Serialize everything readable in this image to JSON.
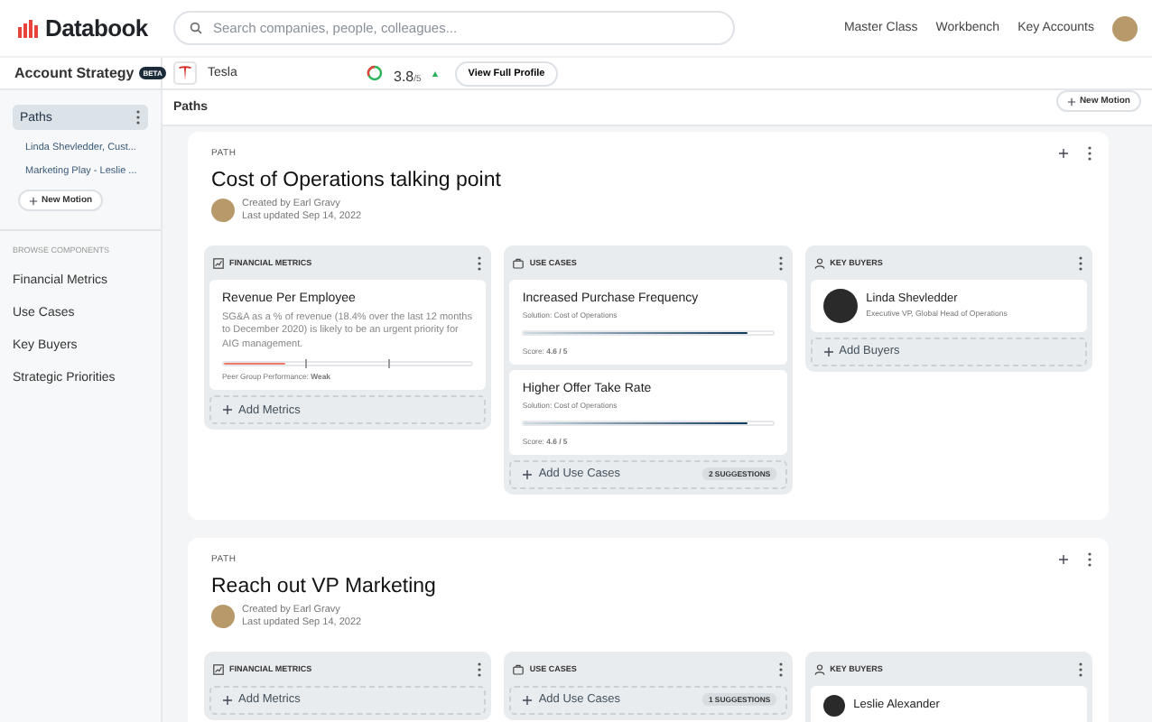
{
  "topbar": {
    "brand": "Databook",
    "search": {
      "placeholder": "Search companies, people, colleagues..."
    },
    "links": [
      "Master Class",
      "Workbench",
      "Key Accounts"
    ]
  },
  "sidebar": {
    "title": "Account Strategy",
    "badge": "BETA",
    "section": {
      "label": "Paths",
      "selected": true
    },
    "paths": [
      "Linda Shevledder, Cust...",
      "Marketing Play - Leslie ..."
    ],
    "new_motion": "New Motion",
    "browse_label": "BROWSE COMPONENTS",
    "items": [
      "Financial Metrics",
      "Use Cases",
      "Key Buyers",
      "Strategic Priorities"
    ]
  },
  "company": {
    "name": "Tesla",
    "score": "3.8",
    "scale": "/5",
    "profile_button": "View Full Profile"
  },
  "paths_bar": {
    "title": "Paths",
    "new_motion": "New Motion"
  },
  "paths": [
    {
      "label": "PATH",
      "title": "Cost of Operations talking point",
      "created": "Created by Earl Gravy",
      "updated": "Last updated Sep 14, 2022",
      "columns": [
        {
          "kind": "metrics",
          "title": "FINANCIAL METRICS",
          "add": "Add Metrics",
          "items": [
            {
              "title": "Revenue Per Employee",
              "text": "SG&A as a % of revenue (18.4% over the last 12 months to December 2020) is likely to be an urgent priority for AIG management.",
              "level": 0.25,
              "perf_label": "Peer Group Performance:",
              "perf_value": "Weak"
            }
          ]
        },
        {
          "kind": "use_cases",
          "title": "USE CASES",
          "add": "Add Use Cases",
          "suggestions": "2 SUGGESTIONS",
          "items": [
            {
              "title": "Increased Purchase Frequency",
              "solution": "Solution: Cost of Operations",
              "level": 0.9,
              "score_label": "Score:",
              "score": "4.6 / 5"
            },
            {
              "title": "Higher Offer Take Rate",
              "solution": "Solution: Cost of Operations",
              "level": 0.9,
              "score_label": "Score:",
              "score": "4.6 / 5"
            }
          ]
        },
        {
          "kind": "buyers",
          "title": "KEY BUYERS",
          "add": "Add Buyers",
          "items": [
            {
              "name": "Linda Shevledder",
              "role": "Executive VP, Global Head of Operations"
            }
          ]
        }
      ]
    },
    {
      "label": "PATH",
      "title": "Reach out VP Marketing",
      "created": "Created by Earl Gravy",
      "updated": "Last updated Sep 14, 2022",
      "columns": [
        {
          "kind": "metrics",
          "title": "FINANCIAL METRICS",
          "add": "Add Metrics"
        },
        {
          "kind": "use_cases",
          "title": "USE CASES",
          "add": "Add Use Cases",
          "suggestions": "1 SUGGESTIONS"
        },
        {
          "kind": "buyers",
          "title": "KEY BUYERS",
          "items": [
            {
              "name": "Leslie Alexander"
            }
          ]
        }
      ]
    }
  ]
}
